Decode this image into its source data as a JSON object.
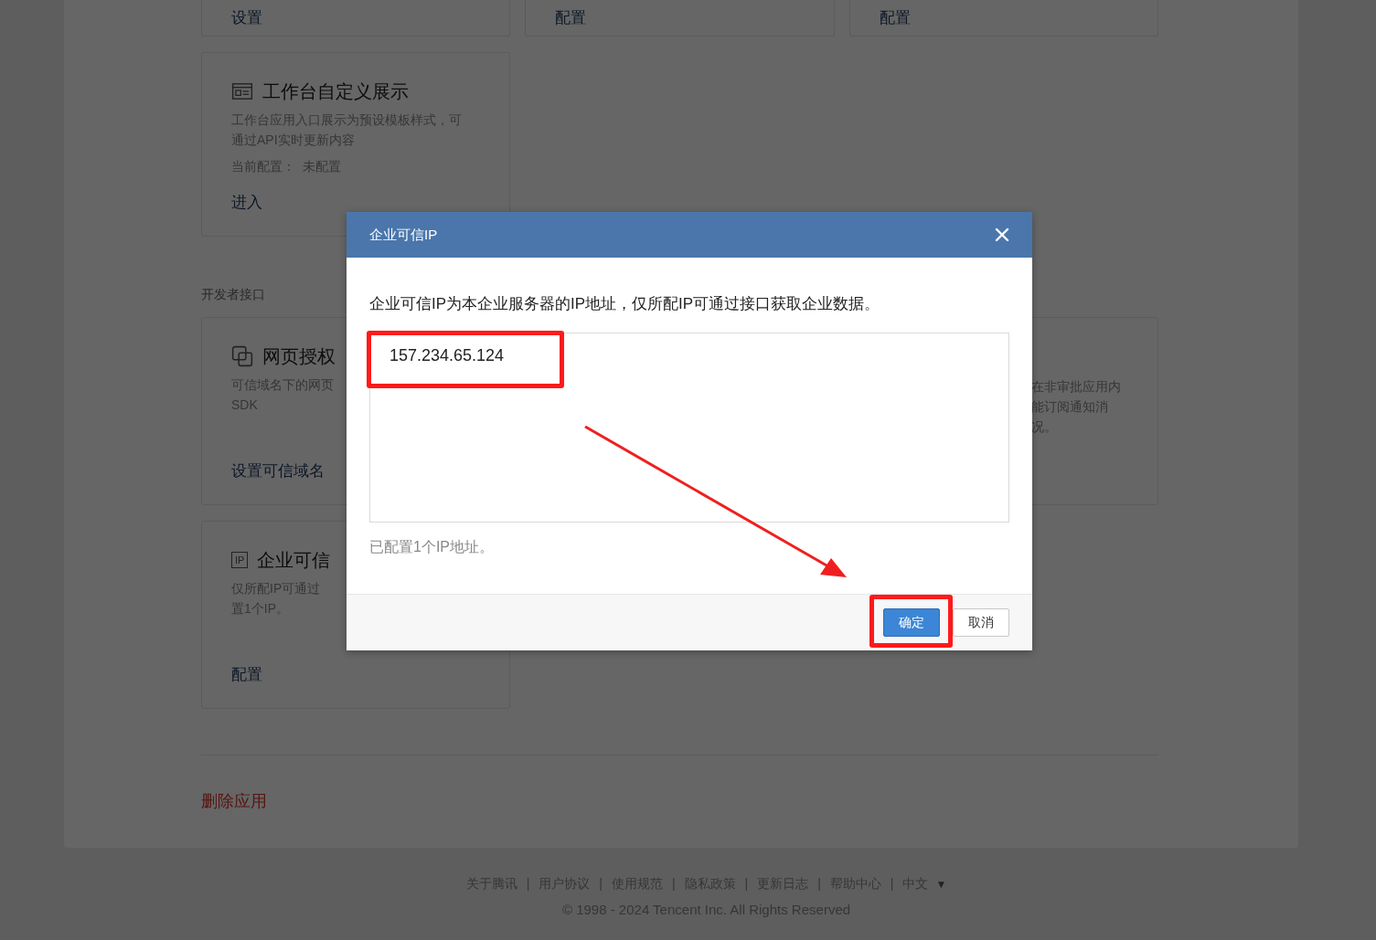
{
  "top_cards": [
    {
      "link": "设置"
    },
    {
      "link": "配置"
    },
    {
      "link": "配置"
    }
  ],
  "app_cards": [
    {
      "kind": "workbench",
      "title": "工作台自定义展示",
      "description": [
        "工作台应用入口展示为预设模板样式，可",
        "通过API实时更新内容"
      ],
      "config_label": "当前配置：",
      "config_value": "未配置",
      "link": "进入"
    }
  ],
  "section_title": "开发者接口",
  "dev_cards": [
    {
      "kind": "webpage",
      "title": "网页授权",
      "description": [
        "可信域名下的网页",
        "SDK"
      ],
      "link": "设置可信域名"
    },
    {
      "kind": "ip",
      "icon_text": "IP",
      "title": "企业可信",
      "description": [
        "仅所配IP可通过",
        "置1个IP。"
      ],
      "link": "配置"
    }
  ],
  "right_card": {
    "description": [
      "在非审批应用内",
      "能订阅通知消",
      "况。"
    ]
  },
  "delete_link": "删除应用",
  "footer": {
    "links": [
      "关于腾讯",
      "用户协议",
      "使用规范",
      "隐私政策",
      "更新日志",
      "帮助中心"
    ],
    "separator": "|",
    "language": "中文",
    "language_caret": "▼",
    "copyright": "© 1998 - 2024 Tencent Inc. All Rights Reserved"
  },
  "dialog": {
    "title": "企业可信IP",
    "description": "企业可信IP为本企业服务器的IP地址，仅所配IP可通过接口获取企业数据。",
    "ip_value": "157.234.65.124",
    "note": "已配置1个IP地址。",
    "buttons": [
      {
        "label": "确定",
        "kind": "primary"
      },
      {
        "label": "取消",
        "kind": "default"
      }
    ]
  }
}
